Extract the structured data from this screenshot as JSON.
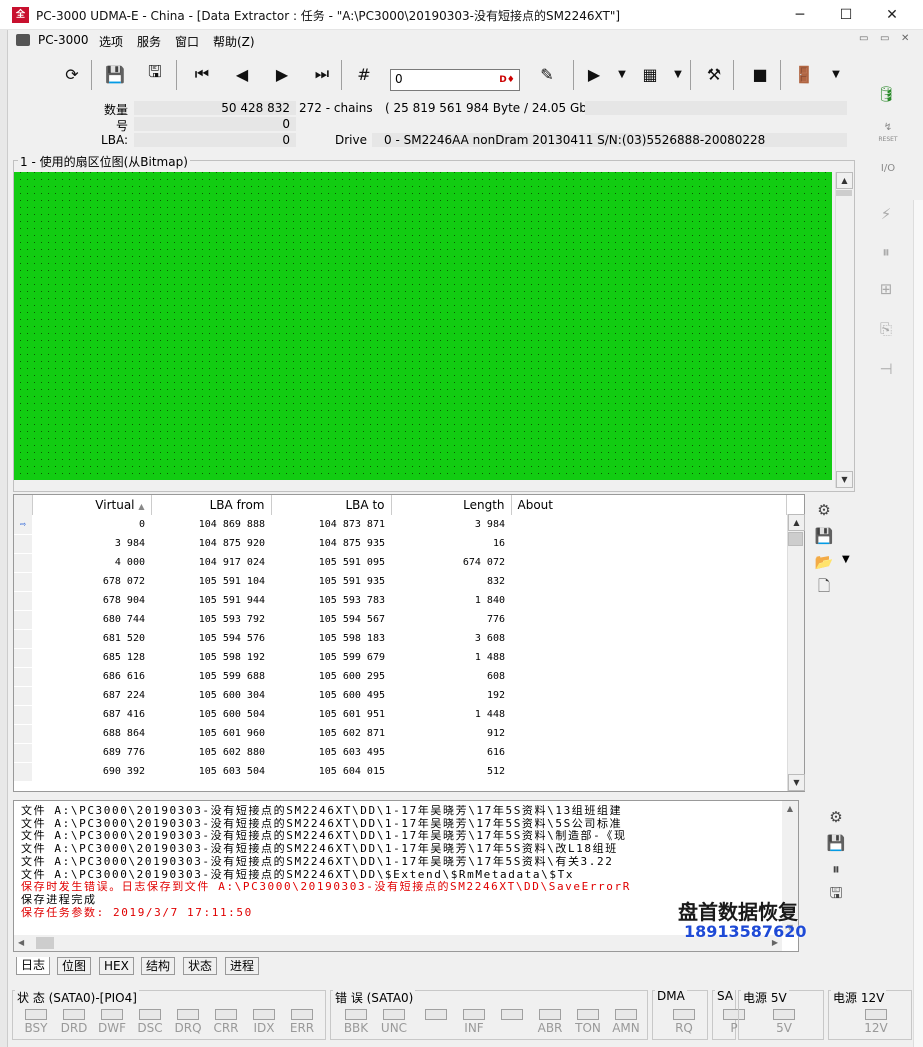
{
  "window": {
    "title": "PC-3000 UDMA-E - China - [Data Extractor : 任务 - \"A:\\PC3000\\20190303-没有短接点的SM2246XT\"]",
    "minimize": "─",
    "maximize": "☐",
    "close": "✕"
  },
  "menu": {
    "items": [
      "PC-3000",
      "选项",
      "服务",
      "窗口",
      "帮助(Z)"
    ],
    "mdi": [
      "▭",
      "▭",
      "✕"
    ]
  },
  "toolbar": {
    "input_value": "0",
    "input_tag": "D♦"
  },
  "info": {
    "count_label": "数量",
    "count_value": "50 428 832",
    "chains": "272 - chains",
    "bytes": "( 25 819 561 984 Byte /  24.05 Gb )",
    "num_label": "号",
    "num_value": "0",
    "lba_label": "LBA:",
    "lba_value": "0",
    "drive_label": "Drive",
    "drive_value": "0 - SM2246AA nonDram 20130411 S/N:(03)5526888-20080228"
  },
  "bitmap": {
    "title": "1 - 使用的扇区位图(从Bitmap)",
    "fill_color": "#13d113"
  },
  "table": {
    "headers": [
      "Virtual",
      "LBA from",
      "LBA to",
      "Length",
      "About"
    ],
    "sort_mark": "▲",
    "rows": [
      [
        "0",
        "104 869 888",
        "104 873 871",
        "3 984"
      ],
      [
        "3 984",
        "104 875 920",
        "104 875 935",
        "16"
      ],
      [
        "4 000",
        "104 917 024",
        "105 591 095",
        "674 072"
      ],
      [
        "678 072",
        "105 591 104",
        "105 591 935",
        "832"
      ],
      [
        "678 904",
        "105 591 944",
        "105 593 783",
        "1 840"
      ],
      [
        "680 744",
        "105 593 792",
        "105 594 567",
        "776"
      ],
      [
        "681 520",
        "105 594 576",
        "105 598 183",
        "3 608"
      ],
      [
        "685 128",
        "105 598 192",
        "105 599 679",
        "1 488"
      ],
      [
        "686 616",
        "105 599 688",
        "105 600 295",
        "608"
      ],
      [
        "687 224",
        "105 600 304",
        "105 600 495",
        "192"
      ],
      [
        "687 416",
        "105 600 504",
        "105 601 951",
        "1 448"
      ],
      [
        "688 864",
        "105 601 960",
        "105 602 871",
        "912"
      ],
      [
        "689 776",
        "105 602 880",
        "105 603 495",
        "616"
      ],
      [
        "690 392",
        "105 603 504",
        "105 604 015",
        "512"
      ]
    ]
  },
  "log": {
    "lines": [
      {
        "text": "文件 A:\\PC3000\\20190303-没有短接点的SM2246XT\\DD\\1-17年吴晓芳\\17年5S资料\\13组班组建",
        "color": "#000"
      },
      {
        "text": "文件 A:\\PC3000\\20190303-没有短接点的SM2246XT\\DD\\1-17年吴晓芳\\17年5S资料\\5S公司标准",
        "color": "#000"
      },
      {
        "text": "文件 A:\\PC3000\\20190303-没有短接点的SM2246XT\\DD\\1-17年吴晓芳\\17年5S资料\\制造部-《现",
        "color": "#000"
      },
      {
        "text": "文件 A:\\PC3000\\20190303-没有短接点的SM2246XT\\DD\\1-17年吴晓芳\\17年5S资料\\改L18组班",
        "color": "#000"
      },
      {
        "text": "文件 A:\\PC3000\\20190303-没有短接点的SM2246XT\\DD\\1-17年吴晓芳\\17年5S资料\\有关3.22",
        "color": "#000"
      },
      {
        "text": "文件 A:\\PC3000\\20190303-没有短接点的SM2246XT\\DD\\$Extend\\$RmMetadata\\$Tx",
        "color": "#000"
      },
      {
        "text": "保存时发生错误。日志保存到文件 A:\\PC3000\\20190303-没有短接点的SM2246XT\\DD\\SaveErrorR",
        "color": "#e00000"
      },
      {
        "text": "保存进程完成",
        "color": "#000"
      },
      {
        "text": "保存任务参数:  2019/3/7  17:11:50",
        "color": "#e00000"
      }
    ]
  },
  "tabs": [
    "日志",
    "位图",
    "HEX",
    "结构",
    "状态",
    "进程"
  ],
  "status": {
    "groups": [
      {
        "title": "状 态 (SATA0)-[PIO4]",
        "leds": [
          "BSY",
          "DRD",
          "DWF",
          "DSC",
          "DRQ",
          "CRR",
          "IDX",
          "ERR"
        ]
      },
      {
        "title": "错 误 (SATA0)",
        "leds": [
          "BBK",
          "UNC",
          "",
          "INF",
          "",
          "ABR",
          "TON",
          "AMN"
        ]
      },
      {
        "title": "DMA",
        "leds": [
          "RQ"
        ]
      },
      {
        "title": "SA",
        "leds": [
          "P"
        ]
      },
      {
        "title": "电源 5V",
        "leds": [
          "5V"
        ]
      },
      {
        "title": "电源 12V",
        "leds": [
          "12V"
        ]
      }
    ]
  },
  "watermark": {
    "name": "盘首数据恢复",
    "phone": "18913587620"
  },
  "right_toolbar": {
    "reset": "RESET",
    "io": "I/O"
  },
  "colors": {
    "ok": "#13d113",
    "error": "#e00000",
    "grid": "#0b5a00"
  }
}
